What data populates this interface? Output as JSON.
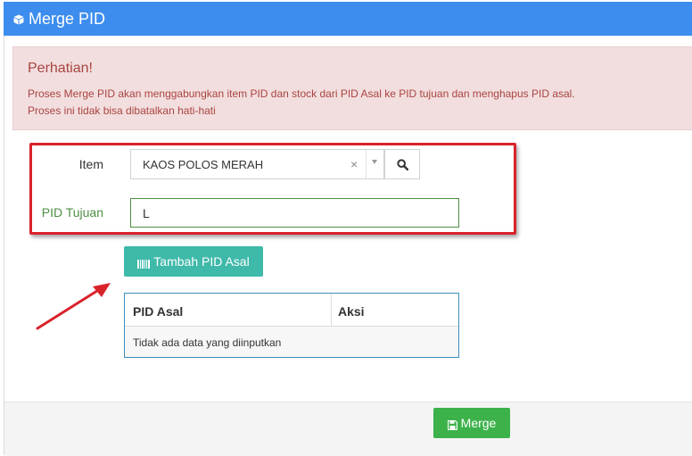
{
  "header": {
    "title": "Merge PID",
    "icon": "cube-icon"
  },
  "alert": {
    "title": "Perhatian!",
    "line1": "Proses Merge PID akan menggabungkan item PID dan stock dari PID Asal ke PID tujuan dan menghapus PID asal.",
    "line2": "Proses ini tidak bisa dibatalkan hati-hati"
  },
  "form": {
    "item_label": "Item",
    "item_value": "KAOS POLOS MERAH",
    "clear_symbol": "×",
    "pid_tujuan_label": "PID Tujuan",
    "pid_tujuan_value": "L"
  },
  "buttons": {
    "tambah": "Tambah PID Asal",
    "merge": "Merge"
  },
  "table": {
    "columns": [
      "PID Asal",
      "Aksi"
    ],
    "empty_text": "Tidak ada data yang diinputkan"
  },
  "colors": {
    "header": "#3c8dee",
    "alert_bg": "#f2dede",
    "alert_text": "#a94442",
    "annotation_red": "#d9232b",
    "tambah_btn": "#3fb9a9",
    "merge_btn": "#3db24b",
    "success_label": "#4e8f44"
  }
}
